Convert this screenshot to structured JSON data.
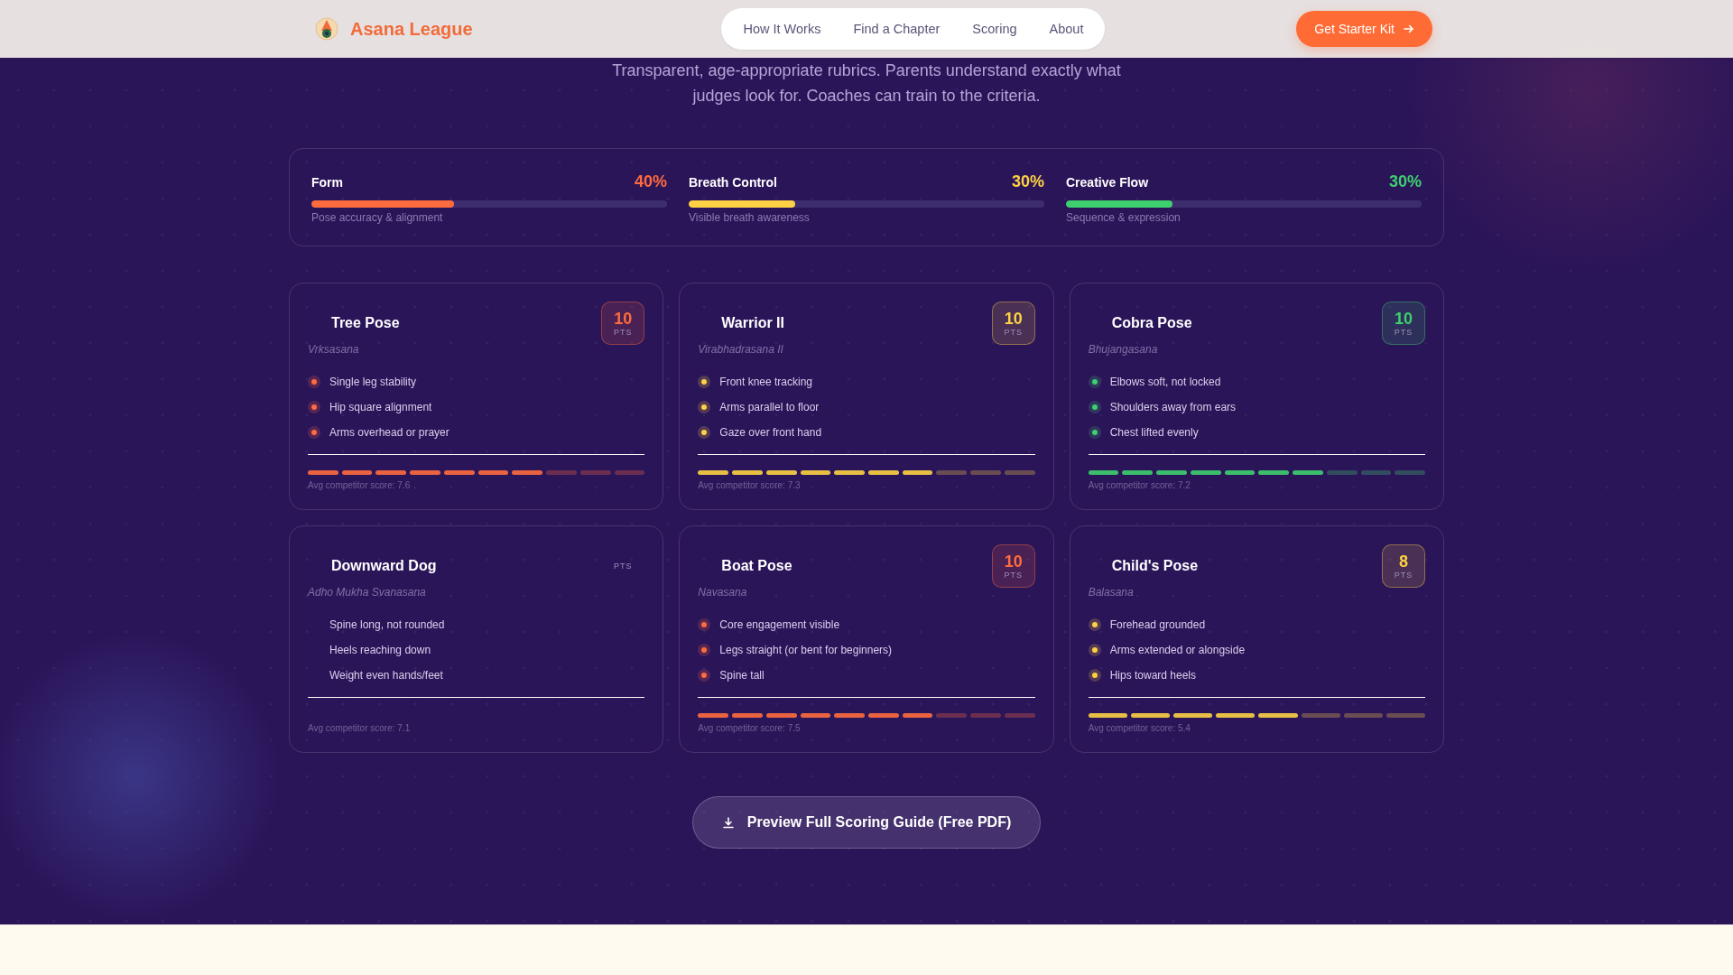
{
  "header": {
    "brand": "Asana League",
    "nav": [
      {
        "label": "How It Works"
      },
      {
        "label": "Find a Chapter"
      },
      {
        "label": "Scoring"
      },
      {
        "label": "About"
      }
    ],
    "cta": "Get Starter Kit"
  },
  "intro": "Transparent, age-appropriate rubrics. Parents understand exactly what judges look for. Coaches can train to the criteria.",
  "metrics": [
    {
      "name": "Form",
      "percent": "40%",
      "level": 0.4,
      "color": "#ff6b3d",
      "description": "Pose accuracy & alignment"
    },
    {
      "name": "Breath Control",
      "percent": "30%",
      "level": 0.3,
      "color": "#fdd143",
      "description": "Visible breath awareness"
    },
    {
      "name": "Creative Flow",
      "percent": "30%",
      "level": 0.3,
      "color": "#3ecf6e",
      "description": "Sequence & expression"
    }
  ],
  "poses": [
    {
      "name": "Tree Pose",
      "sanskrit": "Vrksasana",
      "points": "10",
      "points_label": "PTS",
      "color": "#ff6b3d",
      "criteria": [
        "Single leg stability",
        "Hip square alignment",
        "Arms overhead or prayer"
      ],
      "segments": [
        {
          "filled": true
        },
        {
          "filled": true
        },
        {
          "filled": true
        },
        {
          "filled": true
        },
        {
          "filled": true
        },
        {
          "filled": true
        },
        {
          "filled": true
        },
        {
          "filled": false
        },
        {
          "filled": false
        },
        {
          "filled": false
        }
      ],
      "average": "Avg competitor score: 7.6"
    },
    {
      "name": "Warrior II",
      "sanskrit": "Virabhadrasana II",
      "points": "10",
      "points_label": "PTS",
      "color": "#fdd143",
      "criteria": [
        "Front knee tracking",
        "Arms parallel to floor",
        "Gaze over front hand"
      ],
      "segments": [
        {
          "filled": true
        },
        {
          "filled": true
        },
        {
          "filled": true
        },
        {
          "filled": true
        },
        {
          "filled": true
        },
        {
          "filled": true
        },
        {
          "filled": true
        },
        {
          "filled": false
        },
        {
          "filled": false
        },
        {
          "filled": false
        }
      ],
      "average": "Avg competitor score: 7.3"
    },
    {
      "name": "Cobra Pose",
      "sanskrit": "Bhujangasana",
      "points": "10",
      "points_label": "PTS",
      "color": "#3ecf6e",
      "criteria": [
        "Elbows soft, not locked",
        "Shoulders away from ears",
        "Chest lifted evenly"
      ],
      "segments": [
        {
          "filled": true
        },
        {
          "filled": true
        },
        {
          "filled": true
        },
        {
          "filled": true
        },
        {
          "filled": true
        },
        {
          "filled": true
        },
        {
          "filled": true
        },
        {
          "filled": false
        },
        {
          "filled": false
        },
        {
          "filled": false
        }
      ],
      "average": "Avg competitor score: 7.2"
    },
    {
      "name": "Downward Dog",
      "sanskrit": "Adho Mukha Svanasana",
      "points_label": "PTS",
      "criteria": [
        "Spine long, not rounded",
        "Heels reaching down",
        "Weight even hands/feet"
      ],
      "average": "Avg competitor score: 7.1"
    },
    {
      "name": "Boat Pose",
      "sanskrit": "Navasana",
      "points": "10",
      "points_label": "PTS",
      "color": "#ff6b3d",
      "criteria": [
        "Core engagement visible",
        "Legs straight (or bent for beginners)",
        "Spine tall"
      ],
      "segments": [
        {
          "filled": true
        },
        {
          "filled": true
        },
        {
          "filled": true
        },
        {
          "filled": true
        },
        {
          "filled": true
        },
        {
          "filled": true
        },
        {
          "filled": true
        },
        {
          "filled": false
        },
        {
          "filled": false
        },
        {
          "filled": false
        }
      ],
      "average": "Avg competitor score: 7.5"
    },
    {
      "name": "Child's Pose",
      "sanskrit": "Balasana",
      "points": "8",
      "points_label": "PTS",
      "color": "#fdd143",
      "criteria": [
        "Forehead grounded",
        "Arms extended or alongside",
        "Hips toward heels"
      ],
      "segments": [
        {
          "filled": true
        },
        {
          "filled": true
        },
        {
          "filled": true
        },
        {
          "filled": true
        },
        {
          "filled": true
        },
        {
          "filled": false
        },
        {
          "filled": false
        },
        {
          "filled": false
        }
      ],
      "average": "Avg competitor score: 5.4"
    }
  ],
  "guide_button": "Preview Full Scoring Guide (Free PDF)"
}
